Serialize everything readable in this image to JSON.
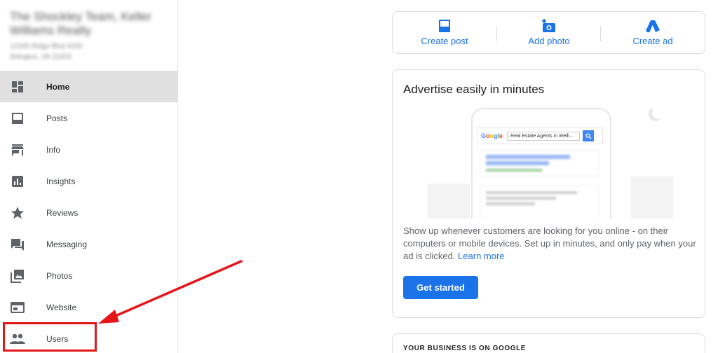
{
  "business": {
    "name": "The Shockley Team, Keller Williams Realty",
    "address_line1": "12345 Ridge Blvd #200",
    "address_line2": "Arlington, VA 22203"
  },
  "sidebar": {
    "items": [
      {
        "label": "Home",
        "icon": "dashboard-icon",
        "active": true
      },
      {
        "label": "Posts",
        "icon": "posts-icon"
      },
      {
        "label": "Info",
        "icon": "store-icon"
      },
      {
        "label": "Insights",
        "icon": "insights-icon"
      },
      {
        "label": "Reviews",
        "icon": "star-icon"
      },
      {
        "label": "Messaging",
        "icon": "message-icon"
      },
      {
        "label": "Photos",
        "icon": "photos-icon"
      },
      {
        "label": "Website",
        "icon": "website-icon"
      },
      {
        "label": "Users",
        "icon": "people-icon"
      }
    ]
  },
  "actions": {
    "create_post": "Create post",
    "add_photo": "Add photo",
    "create_ad": "Create ad"
  },
  "advertise": {
    "title": "Advertise easily in minutes",
    "search_brand": "Google",
    "search_query": "Real Estate Agents in Welli...",
    "description": "Show up whenever customers are looking for you online - on their computers or mobile devices. Set up in minutes, and only pay when your ad is clicked.",
    "learn_more": "Learn more",
    "cta": "Get started"
  },
  "on_google": {
    "title": "YOUR BUSINESS IS ON GOOGLE"
  },
  "colors": {
    "accent": "#1a73e8",
    "annotation": "#e5161a",
    "active_bg": "#e0e0e0"
  }
}
